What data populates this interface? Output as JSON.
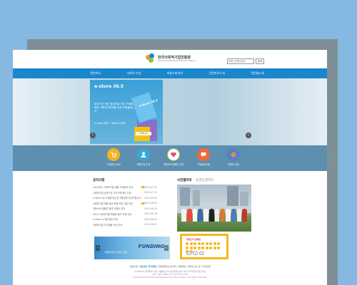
{
  "header": {
    "logo_ko": "한국사회적기업진흥원",
    "logo_en": "Korea Social Enterprise Promotion Agency",
    "search_placeholder": "제품 검색어입력",
    "search_button": "검색"
  },
  "nav": {
    "items": [
      "열린마당",
      "사회적 기업",
      "착한소비안내",
      "전문판로소개",
      "전문몰소개"
    ]
  },
  "hero": {
    "title": "e-store 36.5",
    "text": "공공기관 개인 정부조달 기업 구매를 위한 사회적기업제품 전문 쇼핑몰입니다",
    "phone": "e-store 문의 : 1661-0396",
    "tag": "자세히보기",
    "box_label": "e-store 36.5",
    "prev": "‹",
    "next": "›"
  },
  "quick": {
    "items": [
      {
        "label": "고객센터 Q&A",
        "color": "#f3b31e",
        "icon": "cart-icon"
      },
      {
        "label": "회원가입 안내",
        "color": "#3ba7d6",
        "icon": "user-icon"
      },
      {
        "label": "착한소비 캠페인 안내",
        "color": "#8cc63f",
        "icon": "heart-icon"
      },
      {
        "label": "구매상담신청",
        "color": "#ee6a3b",
        "icon": "chat-icon"
      },
      {
        "label": "판매자 신청",
        "color": "#5b7fc3",
        "icon": "store-icon"
      }
    ]
  },
  "notice": {
    "title": "공지사항",
    "items": [
      {
        "text": "2015년도 사회적기업 제품 구매실적 안내",
        "date": "2015.07.01",
        "new": true
      },
      {
        "text": "사회적기업 공공기관 우선구매 제도 안내",
        "date": "2015.07.01",
        "new": false
      },
      {
        "text": "e-store 36.5 회원가입 및 이용방법 안내드립니다",
        "date": "2015.06.30",
        "new": false
      },
      {
        "text": "사회적기업 제품 홍보 판매 지원 사업 안내",
        "date": "2015.06.25",
        "new": true
      },
      {
        "text": "착한소비 캠페인 참여 이벤트 공지",
        "date": "2015.06.20",
        "new": false
      },
      {
        "text": "2015 사회적기업 박람회 참가 모집 안내",
        "date": "2015.06.18",
        "new": false
      },
      {
        "text": "e-store 시스템 점검 안내",
        "date": "2015.06.10",
        "new": false
      },
      {
        "text": "사회적기업 우수제품 추천 안내",
        "date": "2015.06.05",
        "new": false
      }
    ],
    "new_label": "N"
  },
  "photo": {
    "title": "사진갤러리",
    "sub": "동영상갤러리"
  },
  "banner1": {
    "text": "FUNDING",
    "sub": "사회적기업 크라우드 펀딩"
  },
  "banner2": {
    "title": "착한소비 캠페인",
    "links": [
      "f",
      "t",
      "b"
    ]
  },
  "footer": {
    "links": [
      "이용안내",
      "개인정보 처리방침",
      "이메일무단수집거부",
      "이용약관",
      "찾아오시는 길",
      "사이트맵"
    ],
    "lines": [
      "(우)04510 서울특별시 중구 세종대로 39 상공회의소회관 7층  한국사회적기업진흥원",
      "TEL. 1661-0396  FAX. 02-6742-1410",
      "Copyright(c)Korea Social Enterprise Promotion Agency. All rights reserved."
    ]
  }
}
